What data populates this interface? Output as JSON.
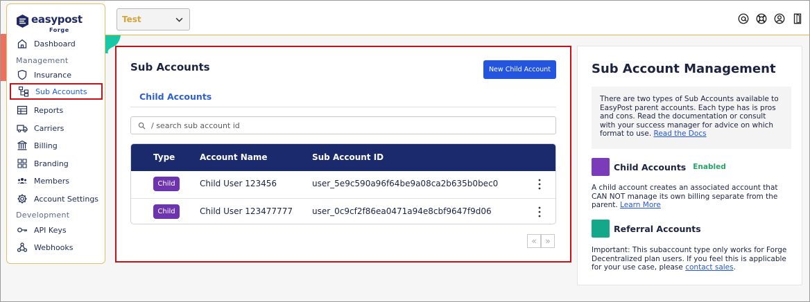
{
  "topbar": {
    "environment": "Test",
    "icons": [
      "at-sign-icon",
      "help-lifebuoy-icon",
      "user-profile-icon",
      "exit-door-icon"
    ]
  },
  "brand": {
    "name": "easypost",
    "sub": "Forge"
  },
  "sidebar": {
    "sections": {
      "management": "Management",
      "development": "Development"
    },
    "items": [
      {
        "label": "Dashboard",
        "icon": "home-icon"
      },
      {
        "label": "Insurance",
        "icon": "shield-icon"
      },
      {
        "label": "Sub Accounts",
        "icon": "hierarchy-icon",
        "active": true
      },
      {
        "label": "Reports",
        "icon": "table-icon"
      },
      {
        "label": "Carriers",
        "icon": "truck-icon"
      },
      {
        "label": "Billing",
        "icon": "bank-icon"
      },
      {
        "label": "Branding",
        "icon": "puzzle-icon"
      },
      {
        "label": "Members",
        "icon": "members-icon"
      },
      {
        "label": "Account Settings",
        "icon": "gear-icon"
      },
      {
        "label": "API Keys",
        "icon": "key-icon"
      },
      {
        "label": "Webhooks",
        "icon": "webhook-icon"
      }
    ]
  },
  "main": {
    "title": "Sub Accounts",
    "new_button": "New Child Account",
    "tab": "Child Accounts",
    "search_placeholder": "/ search sub account id",
    "table": {
      "headers": [
        "Type",
        "Account Name",
        "Sub Account ID"
      ],
      "rows": [
        {
          "type": "Child",
          "name": "Child User 123456",
          "id": "user_5e9c590a96f64be9a08ca2b635b0bec0"
        },
        {
          "type": "Child",
          "name": "Child User 123477777",
          "id": "user_0c9cf2f86ea0471a94e8cbf9647f9d06"
        }
      ]
    },
    "pager": {
      "prev": "«",
      "next": "»"
    }
  },
  "info": {
    "title": "Sub Account Management",
    "intro": "There are two types of Sub Accounts available to EasyPost parent accounts. Each type has is pros and cons. Read the documentation or consult with your success manager for advice on which format to use.",
    "intro_link": "Read the Docs",
    "child": {
      "name": "Child Accounts",
      "status": "Enabled",
      "desc": "A child account creates an associated account that CAN NOT manage its own billing separate from the parent.",
      "link": "Learn More",
      "color": "#7a3cb8"
    },
    "referral": {
      "name": "Referral Accounts",
      "desc": "Important: This subaccount type only works for Forge Decentralized plan users. If you feel this is applicable for your use case, please",
      "link": "contact sales",
      "color": "#14a88a"
    }
  },
  "colors": {
    "accent": "#2355e0",
    "header": "#1a2a6c",
    "badge": "#6e34b0",
    "highlight": "#cc0f14"
  }
}
